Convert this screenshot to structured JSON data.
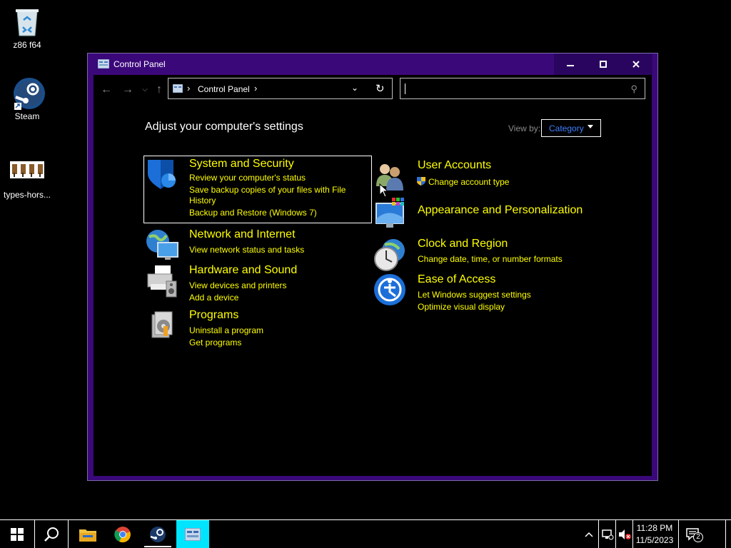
{
  "desktop": {
    "icons": [
      {
        "label": "z86 f64"
      },
      {
        "label": "Steam"
      },
      {
        "label": "types-hors..."
      }
    ]
  },
  "window": {
    "title": "Control Panel",
    "address": {
      "crumb": "Control Panel"
    },
    "search": {
      "placeholder": ""
    },
    "heading": "Adjust your computer's settings",
    "view_by_label": "View by:",
    "view_by_value": "Category",
    "categories_left": [
      {
        "title": "System and Security",
        "links": [
          "Review your computer's status",
          "Save backup copies of your files with File",
          "History",
          "Backup and Restore (Windows 7)"
        ],
        "icon": "shield-icon"
      },
      {
        "title": "Network and Internet",
        "links": [
          "View network status and tasks"
        ],
        "icon": "network-icon"
      },
      {
        "title": "Hardware and Sound",
        "links": [
          "View devices and printers",
          "Add a device"
        ],
        "icon": "printer-icon"
      },
      {
        "title": "Programs",
        "links": [
          "Uninstall a program",
          "Get programs"
        ],
        "icon": "programs-icon"
      }
    ],
    "categories_right": [
      {
        "title": "User Accounts",
        "links": [
          "Change account type"
        ],
        "icon": "users-icon"
      },
      {
        "title": "Appearance and Personalization",
        "links": [],
        "icon": "monitor-icon"
      },
      {
        "title": "Clock and Region",
        "links": [
          "Change date, time, or number formats"
        ],
        "icon": "clock-icon"
      },
      {
        "title": "Ease of Access",
        "links": [
          "Let Windows suggest settings",
          "Optimize visual display"
        ],
        "icon": "ease-icon"
      }
    ]
  },
  "taskbar": {
    "time": "11:28 PM",
    "date": "11/5/2023",
    "notification_count": "2"
  },
  "colors": {
    "accent": "#3b087a",
    "link": "#ffff00",
    "viewby": "#3f7fff"
  }
}
